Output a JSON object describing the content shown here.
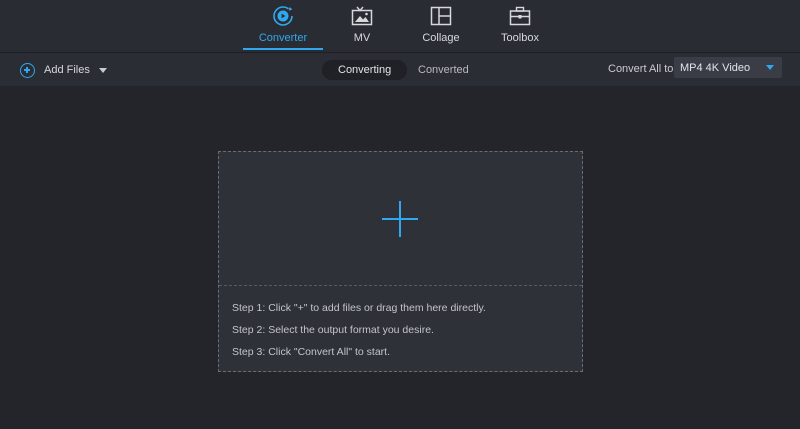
{
  "nav": {
    "tabs": [
      {
        "label": "Converter",
        "icon": "converter-icon",
        "active": true
      },
      {
        "label": "MV",
        "icon": "mv-icon",
        "active": false
      },
      {
        "label": "Collage",
        "icon": "collage-icon",
        "active": false
      },
      {
        "label": "Toolbox",
        "icon": "toolbox-icon",
        "active": false
      }
    ]
  },
  "toolbar": {
    "add_files_label": "Add Files",
    "segments": [
      "Converting",
      "Converted"
    ],
    "active_segment": "Converting",
    "convert_all_label": "Convert All to:",
    "format_value": "MP4 4K Video"
  },
  "dropzone": {
    "steps": [
      "Step 1: Click \"+\" to add files or drag them here directly.",
      "Step 2: Select the output format you desire.",
      "Step 3: Click \"Convert All\" to start."
    ]
  },
  "colors": {
    "accent": "#2fa8f0",
    "background": "#23252b",
    "header": "#2a2c33"
  }
}
